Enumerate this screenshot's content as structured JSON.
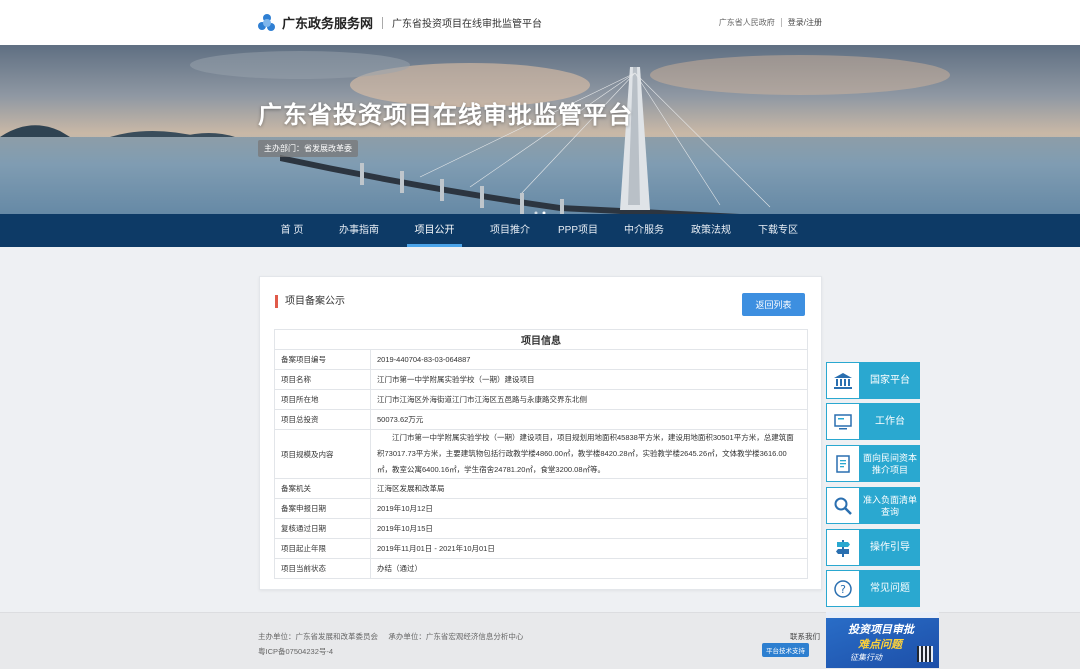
{
  "header": {
    "site_name": "广东政务服务网",
    "platform_name": "广东省投资项目在线审批监管平台",
    "gov_link": "广东省人民政府",
    "login_link": "登录/注册"
  },
  "banner": {
    "title": "广东省投资项目在线审批监管平台",
    "dept": "主办部门：省发展改革委"
  },
  "nav": {
    "items": [
      "首 页",
      "办事指南",
      "项目公开",
      "项目推介",
      "PPP项目",
      "中介服务",
      "政策法规",
      "下载专区"
    ],
    "active_index": 2
  },
  "panel": {
    "title": "项目备案公示",
    "return_button": "返回列表",
    "table_title": "项目信息",
    "rows": [
      {
        "label": "备案项目编号",
        "value": "2019-440704-83-03-064887"
      },
      {
        "label": "项目名称",
        "value": "江门市第一中学附属实验学校（一期）建设项目"
      },
      {
        "label": "项目所在地",
        "value": "江门市江海区外海街道江门市江海区五邑路与永康路交界东北侧"
      },
      {
        "label": "项目总投资",
        "value": "50073.62万元"
      },
      {
        "label": "项目规模及内容",
        "value": "江门市第一中学附属实验学校（一期）建设项目，项目规划用地面积45838平方米，建设用地面积30501平方米，总建筑面积73017.73平方米，主要建筑物包括行政教学楼4860.00㎡，教学楼8420.28㎡，实验教学楼2645.26㎡，文体教学楼3616.00㎡，教室公寓6400.16㎡，学生宿舍24781.20㎡，食堂3200.08㎡等。"
      },
      {
        "label": "备案机关",
        "value": "江海区发展和改革局"
      },
      {
        "label": "备案申报日期",
        "value": "2019年10月12日"
      },
      {
        "label": "复核通过日期",
        "value": "2019年10月15日"
      },
      {
        "label": "项目起止年限",
        "value": "2019年11月01日 - 2021年10月01日"
      },
      {
        "label": "项目当前状态",
        "value": "办结（通过）"
      }
    ]
  },
  "side": {
    "national": "国家平台",
    "workbench": "工作台",
    "private_capital": "面向民间资本推介项目",
    "negative_list": "准入负面清单查询",
    "guide": "操作引导",
    "faq": "常见问题"
  },
  "footer": {
    "sponsor": "主办单位：广东省发展和改革委员会",
    "organizer": "承办单位：广东省宏观经济信息分析中心",
    "icp": "粤ICP备07504232号-4",
    "contact": "联系我们",
    "support": "平台技术支持"
  },
  "ad": {
    "line1": "投资项目审批",
    "line2": "难点问题",
    "line3": "征集行动"
  },
  "colors": {
    "nav_bg": "#0d3a66",
    "accent_blue": "#3d8fe0",
    "side_teal": "#2aa8d0",
    "title_marker": "#e05a4a"
  }
}
